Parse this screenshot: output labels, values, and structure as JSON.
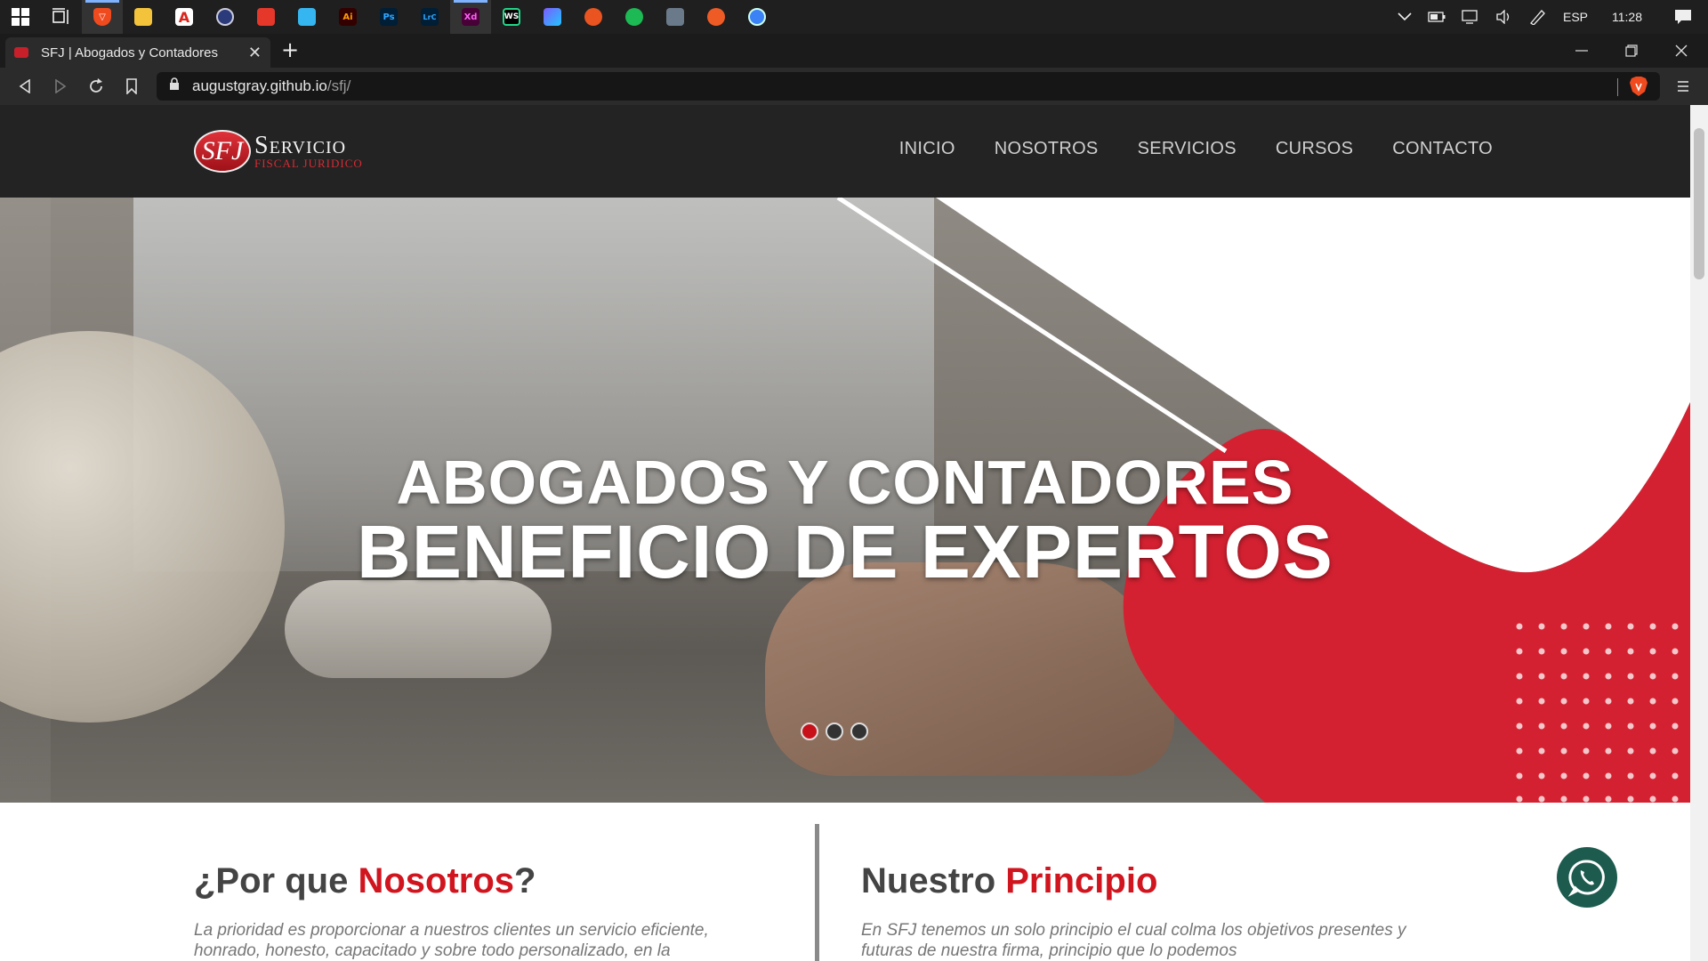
{
  "taskbar": {
    "apps": [
      {
        "name": "start",
        "label": ""
      },
      {
        "name": "task-view",
        "label": ""
      },
      {
        "name": "brave",
        "label": ""
      },
      {
        "name": "file-explorer",
        "label": ""
      },
      {
        "name": "acrobat",
        "label": "A"
      },
      {
        "name": "app-circle",
        "label": ""
      },
      {
        "name": "app-red-shield",
        "label": ""
      },
      {
        "name": "app-blue",
        "label": ""
      },
      {
        "name": "illustrator",
        "label": "Ai"
      },
      {
        "name": "photoshop",
        "label": "Ps"
      },
      {
        "name": "lightroom",
        "label": "LrC"
      },
      {
        "name": "xd",
        "label": "Xd"
      },
      {
        "name": "webstorm",
        "label": "WS"
      },
      {
        "name": "app-gradient",
        "label": ""
      },
      {
        "name": "app-orange",
        "label": ""
      },
      {
        "name": "spotify",
        "label": ""
      },
      {
        "name": "app-tools",
        "label": ""
      },
      {
        "name": "app-orange-2",
        "label": ""
      },
      {
        "name": "app-blue-circle",
        "label": ""
      }
    ],
    "tray": {
      "language": "ESP",
      "time": "11:28"
    }
  },
  "browser": {
    "tab_title": "SFJ | Abogados y Contadores",
    "url_host": "augustgray.github.io",
    "url_path": "/sfj/"
  },
  "site": {
    "logo_mark": "SFJ",
    "logo_title": "Servicio",
    "logo_subtitle": "Fiscal Juridico",
    "menu": [
      "INICIO",
      "NOSOTROS",
      "SERVICIOS",
      "CURSOS",
      "CONTACTO"
    ],
    "hero": {
      "line1": "ABOGADOS Y CONTADORES",
      "line2": "BENEFICIO DE EXPERTOS",
      "slides": 3,
      "active_slide": 1
    },
    "left_col": {
      "title_prefix": "¿Por que ",
      "title_accent": "Nosotros",
      "title_suffix": "?",
      "text": "La prioridad es proporcionar a nuestros clientes un servicio eficiente, honrado, honesto, capacitado y sobre todo personalizado, en la"
    },
    "right_col": {
      "title_prefix": "Nuestro ",
      "title_accent": "Principio",
      "text": "En SFJ tenemos un solo principio el cual colma los objetivos presentes y futuras de nuestra firma, principio que lo podemos"
    }
  },
  "colors": {
    "accent_red": "#d0151f",
    "header_dark": "#232323",
    "whatsapp_green": "#1d5b4f"
  }
}
